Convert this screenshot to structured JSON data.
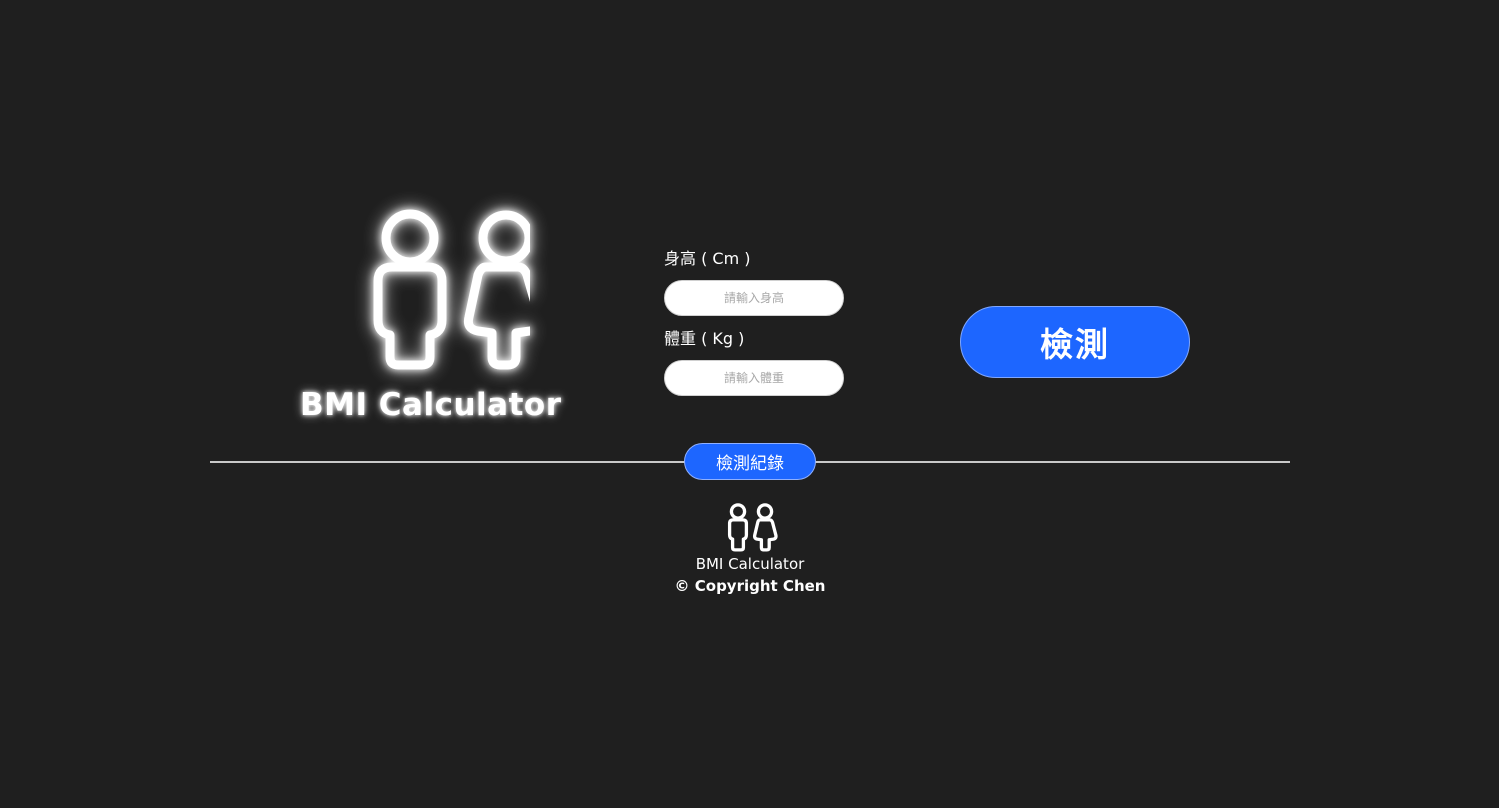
{
  "logo": {
    "icon": "male-female-icon",
    "title": "BMI Calculator"
  },
  "form": {
    "height": {
      "label": "身高 ( Cm )",
      "placeholder": "請輸入身高",
      "value": ""
    },
    "weight": {
      "label": "體重 ( Kg )",
      "placeholder": "請輸入體重",
      "value": ""
    }
  },
  "detect_button": {
    "label": "檢測"
  },
  "records_button": {
    "label": "檢測紀錄"
  },
  "footer": {
    "icon": "male-female-icon",
    "title": "BMI Calculator",
    "copyright": "© Copyright Chen"
  },
  "colors": {
    "background": "#1f1f1f",
    "accent": "#1d66ff",
    "text": "#ffffff",
    "divider": "#c9c9c9"
  }
}
